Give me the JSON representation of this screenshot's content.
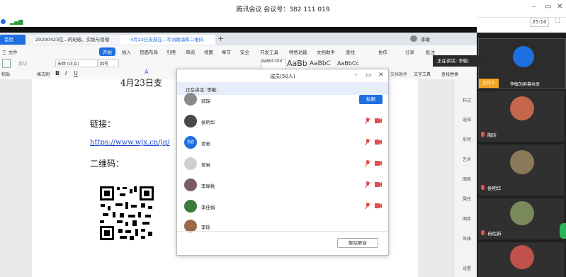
{
  "window": {
    "title": "腾讯会议 会议号：382 111 019",
    "timer": "25:10"
  },
  "wps_tabs": [
    {
      "label": "首页"
    },
    {
      "label": "20200423在...的班级、实践与管理"
    },
    {
      "label": "4月23日支部在...写词朗诵和二维码"
    }
  ],
  "wps_user": "李敏",
  "menu": {
    "file": "三 文件",
    "start": "开始",
    "items": [
      "插入",
      "页面布局",
      "引用",
      "审阅",
      "视图",
      "章节",
      "安全",
      "开发工具",
      "特色功能",
      "文档助手",
      "查找"
    ],
    "collab": "协作",
    "share": "分享",
    "annotate": "批注"
  },
  "toolbar": {
    "paste": "粘贴",
    "cut": "剪切",
    "format_painter": "格式刷",
    "font": "宋体 (正文)",
    "size": "四号",
    "styles": [
      "AaBbCcDd",
      "AaBb",
      "AaBbC",
      "AaBbCc"
    ],
    "text_tools": "文字工具",
    "find_replace": "查找替换",
    "doc_assist": "文档助手",
    "select": "选择"
  },
  "document": {
    "heading_fragment": "4月23日支",
    "link_label": "链接：",
    "link_text": "https://www.wjx.cn/jq/",
    "qr_label": "二维码："
  },
  "side_panel": [
    "样式",
    "选择",
    "形状",
    "艺术",
    "图表",
    "属性",
    "图库",
    "风格",
    "设置"
  ],
  "members_dialog": {
    "title": "成员(50人)",
    "speaking": "正在讲话: 李敏;",
    "private_chat": "私聊",
    "unmute_all": "解除静音",
    "members": [
      {
        "name": "郭琛",
        "avatar_color": "#8a8a8a"
      },
      {
        "name": "侯明华",
        "avatar_color": "#4a4a4a"
      },
      {
        "name": "贾岩",
        "avatar_color": "#1e6fe0",
        "avatar_text": "贾岩"
      },
      {
        "name": "贾岩",
        "avatar_color": "#d0d0d0"
      },
      {
        "name": "李犀桃",
        "avatar_color": "#7a5a6a"
      },
      {
        "name": "李佳娟",
        "avatar_color": "#3a7a3a"
      },
      {
        "name": "李瑶",
        "avatar_color": "#9a6a4a"
      }
    ]
  },
  "video_panel": {
    "speaking_tooltip": "正在讲话: 李敏;",
    "host_badge": "主持人",
    "host_share": "李敏的屏幕共享",
    "participants": [
      {
        "name": "陶玲"
      },
      {
        "name": "侯明华"
      },
      {
        "name": "冉佐新"
      }
    ]
  },
  "colors": {
    "accent_blue": "#1e6fe0",
    "host_orange": "#f5a623",
    "muted_red": "#e05050"
  }
}
